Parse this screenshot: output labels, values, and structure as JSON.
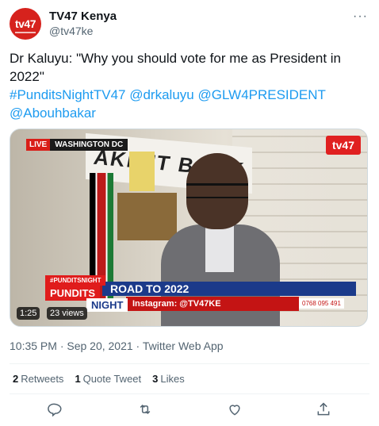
{
  "author": {
    "name": "TV47 Kenya",
    "handle": "@tv47ke",
    "avatar_text": "tv47"
  },
  "tweet": {
    "text": "Dr Kaluyu: \"Why you should vote for me as President in 2022\"",
    "hashtags": [
      "#PunditsNightTV47",
      "@drkaluyu",
      "@GLW4PRESIDENT",
      "@Abouhbakar"
    ]
  },
  "video": {
    "live_label": "LIVE",
    "location": "WASHINGTON DC",
    "banner_text": "AKE IT BACK",
    "logo": "tv47",
    "tag": "#PUNDITSNIGHT",
    "show_top": "PUNDITS",
    "show_bottom": "NIGHT",
    "headline": "ROAD TO 2022",
    "instagram": "Instagram: @TV47KE",
    "phone": "0768 095 491",
    "duration": "1:25",
    "views": "23 views"
  },
  "meta": {
    "timestamp": "10:35 PM · Sep 20, 2021 · Twitter Web App"
  },
  "stats": [
    {
      "count": "2",
      "label": "Retweets"
    },
    {
      "count": "1",
      "label": "Quote Tweet"
    },
    {
      "count": "3",
      "label": "Likes"
    }
  ],
  "actions": [
    "reply-icon",
    "retweet-icon",
    "like-icon",
    "share-icon"
  ],
  "colors": {
    "accent": "#1d9bf0",
    "brand": "#d6221d",
    "muted": "#536471"
  }
}
